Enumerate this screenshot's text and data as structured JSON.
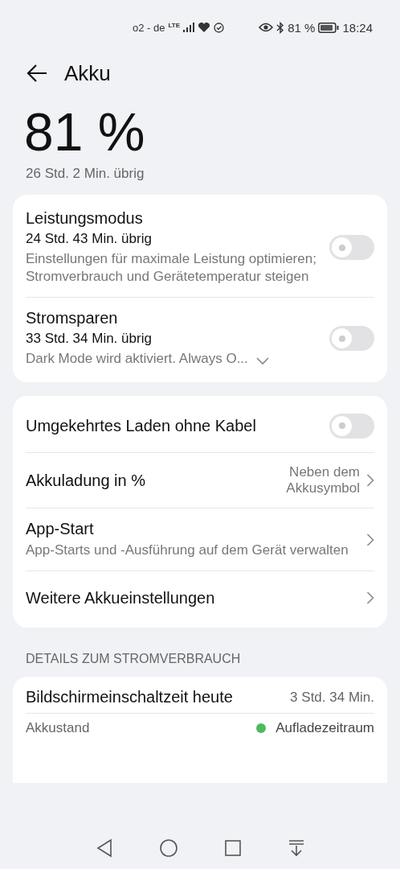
{
  "status_bar": {
    "carrier": "o2 - de",
    "network": "LTE",
    "battery_percent": "81 %",
    "time": "18:24"
  },
  "header": {
    "title": "Akku"
  },
  "battery": {
    "percent": "81 %",
    "remaining": "26 Std. 2 Min. übrig"
  },
  "cards": [
    {
      "rows": [
        {
          "kind": "toggle",
          "title": "Leistungsmodus",
          "subtitle": "24 Std. 43 Min. übrig",
          "description": "Einstellungen für maximale Leistung optimieren; Stromverbrauch und Gerätetemperatur steigen",
          "on": false
        },
        {
          "kind": "toggle",
          "title": "Stromsparen",
          "subtitle": "33 Std. 34 Min. übrig",
          "description": "Dark Mode wird aktiviert. Always O...",
          "expanded": false,
          "on": false
        }
      ]
    },
    {
      "rows": [
        {
          "kind": "toggle",
          "title": "Umgekehrtes Laden ohne Kabel",
          "on": false
        },
        {
          "kind": "link",
          "title": "Akkuladung in %",
          "value": "Neben dem Akkusymbol"
        },
        {
          "kind": "link",
          "title": "App-Start",
          "description": "App-Starts und -Ausführung auf dem Gerät verwalten"
        },
        {
          "kind": "link",
          "title": "Weitere Akkueinstellungen"
        }
      ]
    }
  ],
  "details": {
    "heading": "DETAILS ZUM STROMVERBRAUCH",
    "rows": [
      {
        "kind": "value",
        "label": "Bildschirmeinschaltzeit heute",
        "value": "3 Std. 34 Min."
      },
      {
        "kind": "legend",
        "label": "Akkustand",
        "value": "Aufladezeitraum",
        "color": "#4cbb5c"
      }
    ]
  }
}
